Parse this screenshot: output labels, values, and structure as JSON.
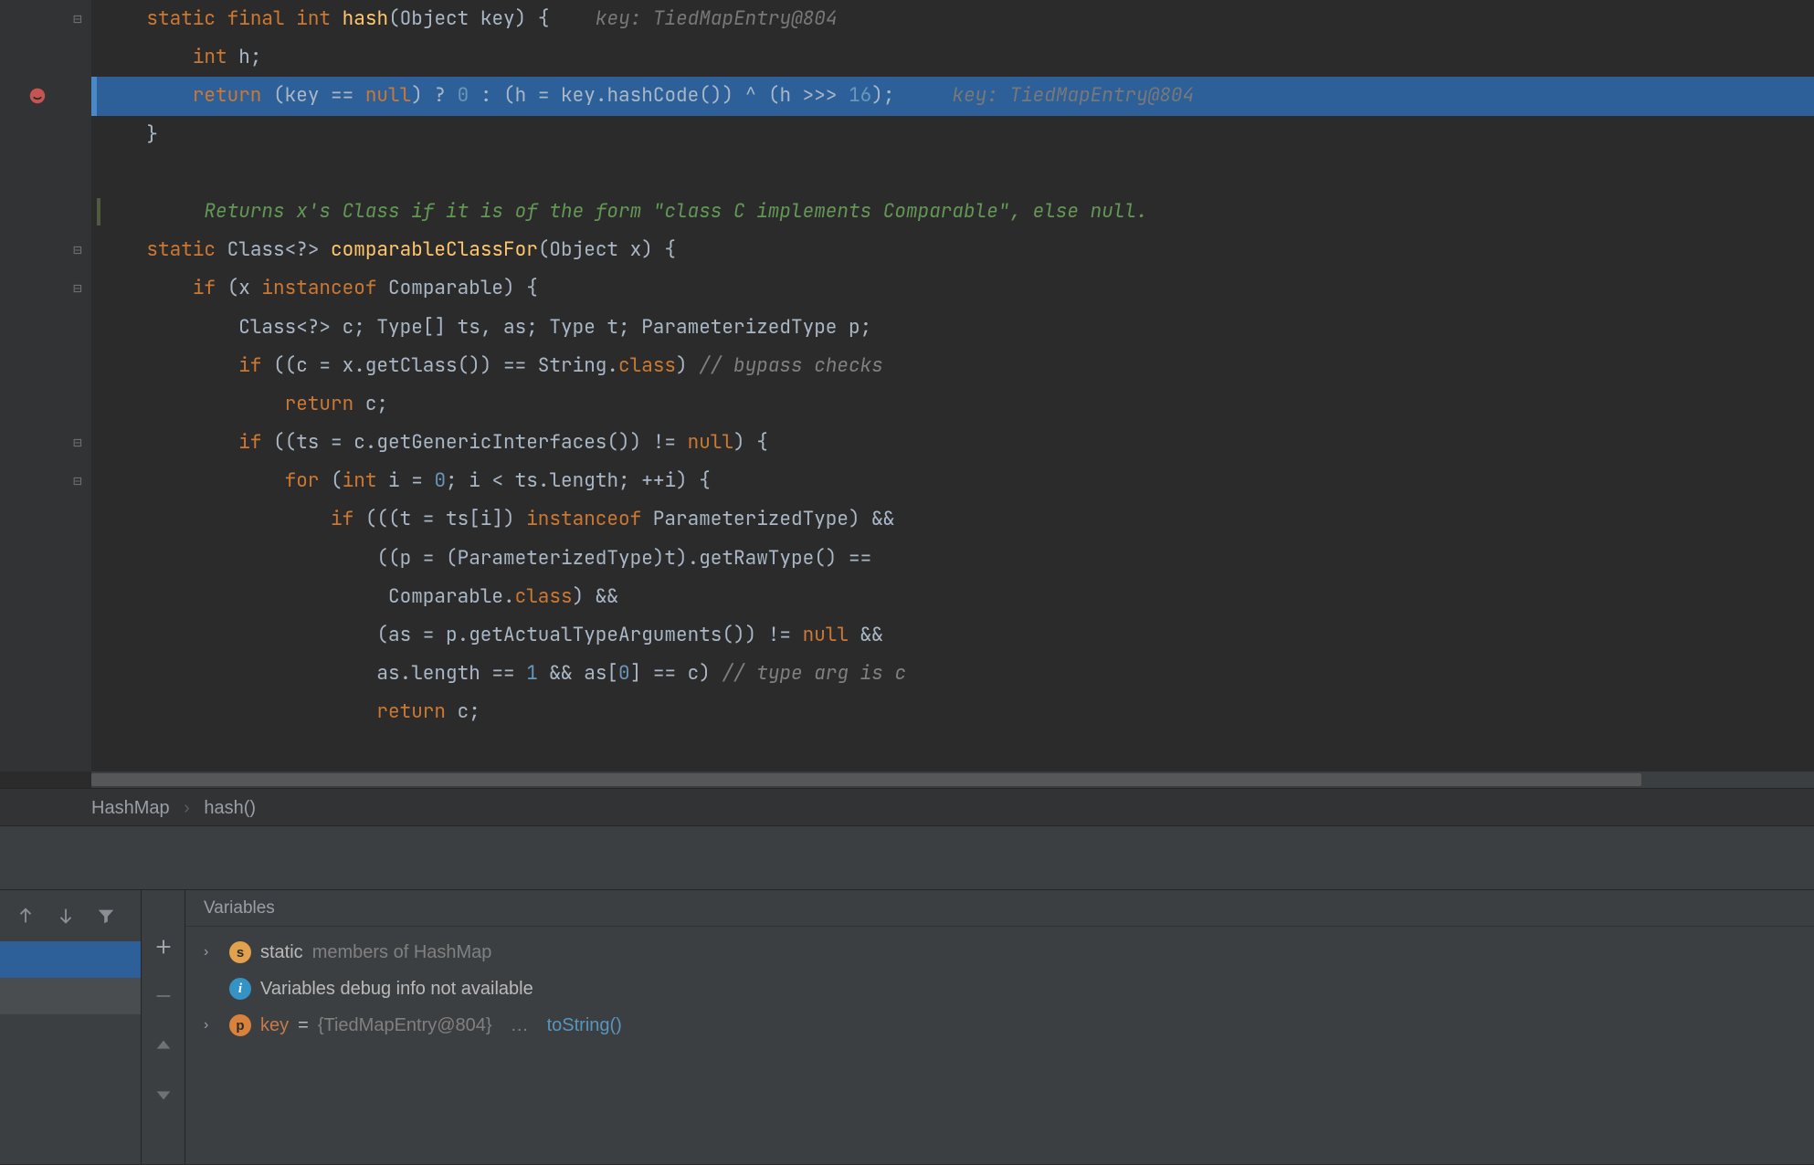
{
  "code_lines": [
    {
      "parts": [
        {
          "cls": "kw",
          "t": "static"
        },
        {
          "cls": "plain",
          "t": " "
        },
        {
          "cls": "kw",
          "t": "final"
        },
        {
          "cls": "plain",
          "t": " "
        },
        {
          "cls": "kw",
          "t": "int"
        },
        {
          "cls": "plain",
          "t": " "
        },
        {
          "cls": "fn",
          "t": "hash"
        },
        {
          "cls": "plain",
          "t": "(Object key) {    "
        },
        {
          "cls": "hint",
          "t": "key: TiedMapEntry@804"
        }
      ],
      "indent": 4,
      "fold": "start"
    },
    {
      "parts": [
        {
          "cls": "kw",
          "t": "int"
        },
        {
          "cls": "plain",
          "t": " h;"
        }
      ],
      "indent": 8
    },
    {
      "hl": true,
      "breakpoint": true,
      "parts": [
        {
          "cls": "kw",
          "t": "return"
        },
        {
          "cls": "plain",
          "t": " (key == "
        },
        {
          "cls": "kw",
          "t": "null"
        },
        {
          "cls": "plain",
          "t": ") ? "
        },
        {
          "cls": "num",
          "t": "0"
        },
        {
          "cls": "plain",
          "t": " : (h = key.hashCode()) ^ (h >>> "
        },
        {
          "cls": "num",
          "t": "16"
        },
        {
          "cls": "plain",
          "t": ");     "
        },
        {
          "cls": "hint",
          "t": "key: TiedMapEntry@804"
        }
      ],
      "indent": 8
    },
    {
      "parts": [
        {
          "cls": "plain",
          "t": "}"
        }
      ],
      "indent": 4,
      "fold": "end"
    },
    {
      "parts": [],
      "indent": 0
    },
    {
      "doc": true,
      "parts": [
        {
          "cls": "doc",
          "t": "Returns x's Class if it is of the form \"class C implements Comparable\", else null."
        }
      ],
      "indent": 6
    },
    {
      "parts": [
        {
          "cls": "kw",
          "t": "static"
        },
        {
          "cls": "plain",
          "t": " Class<?> "
        },
        {
          "cls": "fn",
          "t": "comparableClassFor"
        },
        {
          "cls": "plain",
          "t": "(Object x) {"
        }
      ],
      "indent": 4,
      "fold": "start"
    },
    {
      "parts": [
        {
          "cls": "kw",
          "t": "if"
        },
        {
          "cls": "plain",
          "t": " (x "
        },
        {
          "cls": "kw",
          "t": "instanceof"
        },
        {
          "cls": "plain",
          "t": " Comparable) {"
        }
      ],
      "indent": 8,
      "fold": "start"
    },
    {
      "parts": [
        {
          "cls": "plain",
          "t": "Class<?> c; Type[] ts, as; Type t; ParameterizedType p;"
        }
      ],
      "indent": 12
    },
    {
      "parts": [
        {
          "cls": "kw",
          "t": "if"
        },
        {
          "cls": "plain",
          "t": " ((c = x.getClass()) == String."
        },
        {
          "cls": "kw",
          "t": "class"
        },
        {
          "cls": "plain",
          "t": ") "
        },
        {
          "cls": "cmt",
          "t": "// bypass checks"
        }
      ],
      "indent": 12
    },
    {
      "parts": [
        {
          "cls": "kw",
          "t": "return"
        },
        {
          "cls": "plain",
          "t": " c;"
        }
      ],
      "indent": 16
    },
    {
      "parts": [
        {
          "cls": "kw",
          "t": "if"
        },
        {
          "cls": "plain",
          "t": " ((ts = c.getGenericInterfaces()) != "
        },
        {
          "cls": "kw",
          "t": "null"
        },
        {
          "cls": "plain",
          "t": ") {"
        }
      ],
      "indent": 12,
      "fold": "start"
    },
    {
      "parts": [
        {
          "cls": "kw",
          "t": "for"
        },
        {
          "cls": "plain",
          "t": " ("
        },
        {
          "cls": "kw",
          "t": "int"
        },
        {
          "cls": "plain",
          "t": " i = "
        },
        {
          "cls": "num",
          "t": "0"
        },
        {
          "cls": "plain",
          "t": "; i < ts.length; ++i) {"
        }
      ],
      "indent": 16,
      "fold": "start"
    },
    {
      "parts": [
        {
          "cls": "kw",
          "t": "if"
        },
        {
          "cls": "plain",
          "t": " (((t = ts[i]) "
        },
        {
          "cls": "kw",
          "t": "instanceof"
        },
        {
          "cls": "plain",
          "t": " ParameterizedType) &&"
        }
      ],
      "indent": 20
    },
    {
      "parts": [
        {
          "cls": "plain",
          "t": "((p = (ParameterizedType)t).getRawType() =="
        }
      ],
      "indent": 24
    },
    {
      "parts": [
        {
          "cls": "plain",
          "t": " Comparable."
        },
        {
          "cls": "kw",
          "t": "class"
        },
        {
          "cls": "plain",
          "t": ") &&"
        }
      ],
      "indent": 24
    },
    {
      "parts": [
        {
          "cls": "plain",
          "t": "(as = p.getActualTypeArguments()) != "
        },
        {
          "cls": "kw",
          "t": "null"
        },
        {
          "cls": "plain",
          "t": " &&"
        }
      ],
      "indent": 24
    },
    {
      "parts": [
        {
          "cls": "plain",
          "t": "as.length == "
        },
        {
          "cls": "num",
          "t": "1"
        },
        {
          "cls": "plain",
          "t": " && as["
        },
        {
          "cls": "num",
          "t": "0"
        },
        {
          "cls": "plain",
          "t": "] == c) "
        },
        {
          "cls": "cmt",
          "t": "// type arg is c"
        }
      ],
      "indent": 24
    },
    {
      "parts": [
        {
          "cls": "kw",
          "t": "return"
        },
        {
          "cls": "plain",
          "t": " c;"
        }
      ],
      "indent": 24
    },
    {
      "parts": [
        {
          "cls": "plain",
          "t": ""
        }
      ],
      "indent": 16
    }
  ],
  "breadcrumb": {
    "class": "HashMap",
    "method": "hash()"
  },
  "variables_panel": {
    "title": "Variables",
    "rows": [
      {
        "expandable": true,
        "badge": "s",
        "badgeClass": "badge-s",
        "parts": [
          {
            "cls": "plain",
            "t": "static "
          },
          {
            "cls": "var-gray",
            "t": "members of HashMap"
          }
        ]
      },
      {
        "expandable": false,
        "badge": "i",
        "badgeClass": "badge-i",
        "parts": [
          {
            "cls": "plain",
            "t": "Variables debug info not available"
          }
        ]
      },
      {
        "expandable": true,
        "badge": "p",
        "badgeClass": "badge-p",
        "parts": [
          {
            "cls": "var-name",
            "t": "key"
          },
          {
            "cls": "plain",
            "t": " = "
          },
          {
            "cls": "var-gray",
            "t": "{TiedMapEntry@804}"
          },
          {
            "cls": "plain",
            "t": " "
          },
          {
            "cls": "var-gray",
            "t": "…"
          },
          {
            "cls": "plain",
            "t": " "
          },
          {
            "cls": "var-link",
            "t": "toString()"
          }
        ]
      }
    ]
  }
}
